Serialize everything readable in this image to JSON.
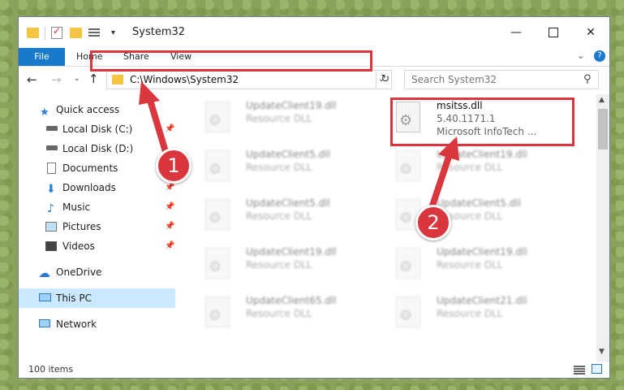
{
  "window": {
    "title": "System32"
  },
  "ribbon": {
    "file": "File",
    "home": "Home",
    "share": "Share",
    "view": "View",
    "help": "?"
  },
  "address": {
    "path": "C:\\Windows\\System32"
  },
  "search": {
    "placeholder": "Search System32"
  },
  "sidebar": {
    "items": [
      {
        "label": "Quick access",
        "icon": "star-icon",
        "pinned": false
      },
      {
        "label": "Local Disk (C:)",
        "icon": "drive-icon",
        "pinned": true
      },
      {
        "label": "Local Disk (D:)",
        "icon": "drive-icon",
        "pinned": false
      },
      {
        "label": "Documents",
        "icon": "documents-icon",
        "pinned": true
      },
      {
        "label": "Downloads",
        "icon": "download-icon",
        "pinned": true
      },
      {
        "label": "Music",
        "icon": "music-icon",
        "pinned": true
      },
      {
        "label": "Pictures",
        "icon": "pictures-icon",
        "pinned": true
      },
      {
        "label": "Videos",
        "icon": "videos-icon",
        "pinned": true
      },
      {
        "label": "OneDrive",
        "icon": "cloud-icon",
        "pinned": false
      },
      {
        "label": "This PC",
        "icon": "computer-icon",
        "pinned": false,
        "selected": true
      },
      {
        "label": "Network",
        "icon": "network-icon",
        "pinned": false
      }
    ]
  },
  "files": [
    {
      "name": "UpdateClient19.dll",
      "type": "Resource DLL"
    },
    {
      "name": "msitss.dll",
      "type": "5.40.1171.1",
      "desc": "Microsoft InfoTech ..."
    },
    {
      "name": "UpdateClient5.dll",
      "type": "Resource DLL"
    },
    {
      "name": "UpdateClient19.dll",
      "type": "Resource DLL"
    },
    {
      "name": "UpdateClient5.dll",
      "type": "Resource DLL"
    },
    {
      "name": "UpdateClient5.dll",
      "type": "Resource DLL"
    },
    {
      "name": "UpdateClient19.dll",
      "type": "Resource DLL"
    },
    {
      "name": "UpdateClient19.dll",
      "type": "Resource DLL"
    },
    {
      "name": "UpdateClient65.dll",
      "type": "Resource DLL"
    },
    {
      "name": "UpdateClient21.dll",
      "type": "Resource DLL"
    }
  ],
  "status": {
    "items": "100 items"
  },
  "markers": {
    "one": "1",
    "two": "2"
  },
  "colors": {
    "accent": "#1979ca",
    "highlight": "#d9363e",
    "selection": "#cce8ff"
  }
}
